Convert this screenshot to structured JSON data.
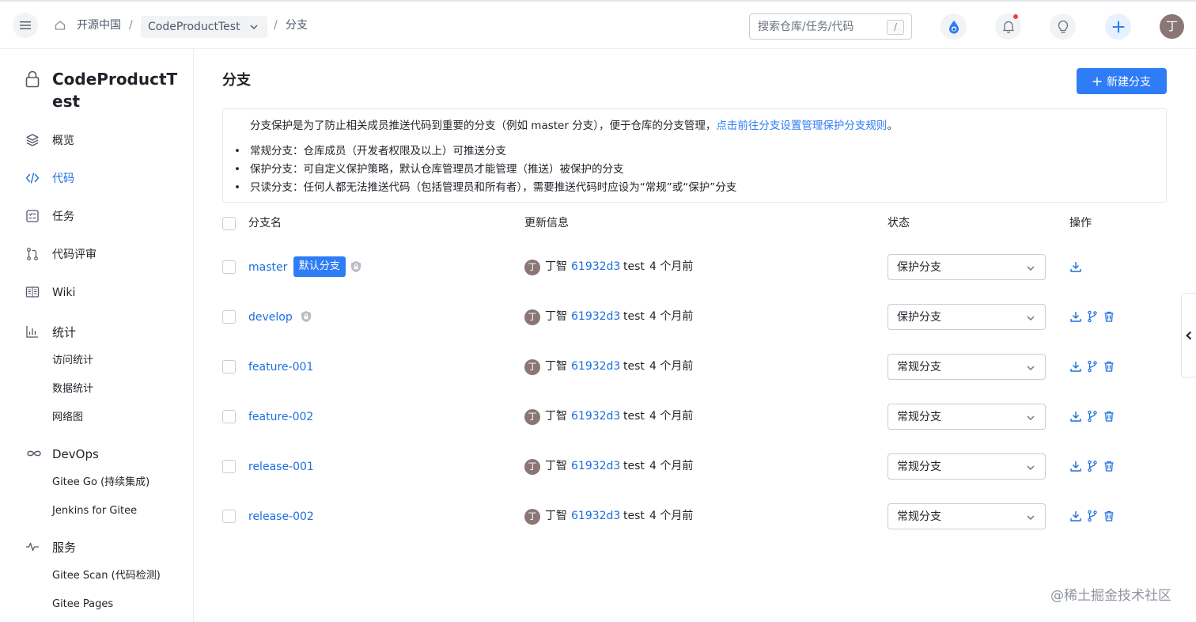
{
  "header": {
    "breadcrumb_root": "开源中国",
    "breadcrumb_repo": "CodeProductTest",
    "breadcrumb_current": "分支",
    "separator": "/",
    "search_placeholder": "搜索仓库/任务/代码",
    "search_shortcut": "/",
    "user_initial": "丁",
    "has_notification": true
  },
  "sidebar": {
    "repo_name": "CodeProductTest",
    "items": [
      {
        "label": "概览",
        "icon": "layers-icon"
      },
      {
        "label": "代码",
        "icon": "code-icon",
        "active": true
      },
      {
        "label": "任务",
        "icon": "task-icon"
      },
      {
        "label": "代码评审",
        "icon": "pull-request-icon"
      },
      {
        "label": "Wiki",
        "icon": "book-icon"
      }
    ],
    "stats": {
      "label": "统计",
      "icon": "bar-chart-icon",
      "subitems": [
        "访问统计",
        "数据统计",
        "网络图"
      ]
    },
    "devops": {
      "label": "DevOps",
      "icon": "infinity-icon",
      "subitems": [
        "Gitee Go (持续集成)",
        "Jenkins for Gitee"
      ]
    },
    "services": {
      "label": "服务",
      "icon": "pulse-icon",
      "subitems": [
        "Gitee Scan (代码检测)",
        "Gitee Pages"
      ]
    }
  },
  "main": {
    "title": "分支",
    "new_branch_label": "新建分支",
    "notice": {
      "intro": "分支保护是为了防止相关成员推送代码到重要的分支（例如 master 分支），便于仓库的分支管理，",
      "link": "点击前往分支设置管理保护分支规则",
      "intro_end": "。",
      "bullets": [
        "常规分支：仓库成员（开发者权限及以上）可推送分支",
        "保护分支：可自定义保护策略，默认仓库管理员才能管理（推送）被保护的分支",
        "只读分支：任何人都无法推送代码（包括管理员和所有者），需要推送代码时应设为“常规”或“保护”分支"
      ]
    },
    "table": {
      "headers": {
        "name": "分支名",
        "update": "更新信息",
        "status": "状态",
        "actions": "操作"
      },
      "default_badge": "默认分支",
      "rows": [
        {
          "name": "master",
          "is_default": true,
          "protected": true,
          "author_initial": "丁",
          "author": "丁智",
          "commit": "61932d3",
          "message": "test",
          "time": "4 个月前",
          "status": "保护分支"
        },
        {
          "name": "develop",
          "is_default": false,
          "protected": true,
          "author_initial": "丁",
          "author": "丁智",
          "commit": "61932d3",
          "message": "test",
          "time": "4 个月前",
          "status": "保护分支"
        },
        {
          "name": "feature-001",
          "is_default": false,
          "protected": false,
          "author_initial": "丁",
          "author": "丁智",
          "commit": "61932d3",
          "message": "test",
          "time": "4 个月前",
          "status": "常规分支"
        },
        {
          "name": "feature-002",
          "is_default": false,
          "protected": false,
          "author_initial": "丁",
          "author": "丁智",
          "commit": "61932d3",
          "message": "test",
          "time": "4 个月前",
          "status": "常规分支"
        },
        {
          "name": "release-001",
          "is_default": false,
          "protected": false,
          "author_initial": "丁",
          "author": "丁智",
          "commit": "61932d3",
          "message": "test",
          "time": "4 个月前",
          "status": "常规分支"
        },
        {
          "name": "release-002",
          "is_default": false,
          "protected": false,
          "author_initial": "丁",
          "author": "丁智",
          "commit": "61932d3",
          "message": "test",
          "time": "4 个月前",
          "status": "常规分支"
        }
      ]
    }
  },
  "credit": "@稀土掘金技术社区",
  "colors": {
    "accent": "#2e7df6",
    "link": "#1b6fdf",
    "avatar": "#8a7775",
    "notification": "#f53f3f"
  }
}
